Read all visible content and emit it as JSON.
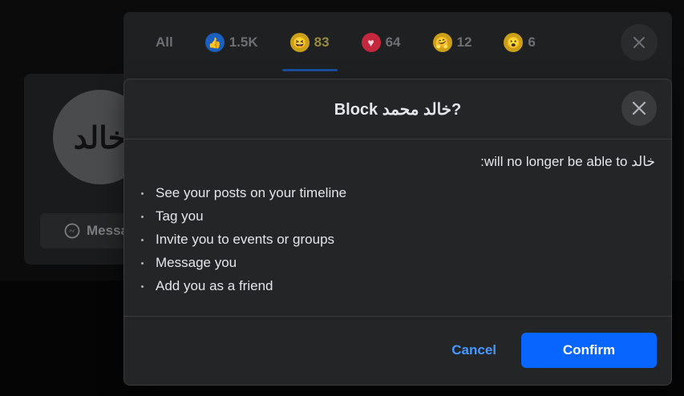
{
  "background": {
    "avatar_text": "خالد",
    "message_button_label": "Messa"
  },
  "reactions": {
    "tabs": [
      {
        "label": "All",
        "count": "",
        "icon": "none"
      },
      {
        "label": "",
        "count": "1.5K",
        "icon": "like-icon"
      },
      {
        "label": "",
        "count": "83",
        "icon": "haha-icon"
      },
      {
        "label": "",
        "count": "64",
        "icon": "love-icon"
      },
      {
        "label": "",
        "count": "12",
        "icon": "care-icon"
      },
      {
        "label": "",
        "count": "6",
        "icon": "wow-icon"
      }
    ],
    "active_tab_index": 2
  },
  "modal": {
    "title": "Block خالد محمد?",
    "lead": "خالد will no longer be able to:",
    "items": [
      "See your posts on your timeline",
      "Tag you",
      "Invite you to events or groups",
      "Message you",
      "Add you as a friend"
    ],
    "cancel_label": "Cancel",
    "confirm_label": "Confirm"
  },
  "colors": {
    "primary": "#0866ff",
    "link": "#4599ff",
    "surface": "#242526"
  }
}
